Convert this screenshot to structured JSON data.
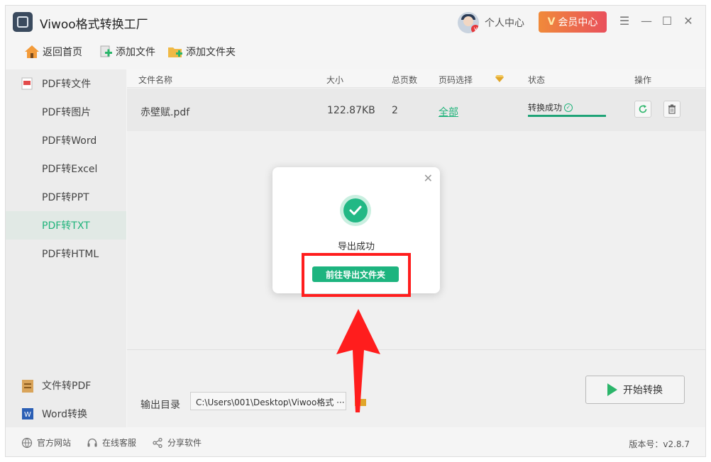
{
  "app": {
    "title": "Viwoo格式转换工厂"
  },
  "header": {
    "user_center": "个人中心",
    "vip_center": "会员中心",
    "vip_badge": "V"
  },
  "toolbar": {
    "home": "返回首页",
    "add_file": "添加文件",
    "add_folder": "添加文件夹"
  },
  "sidebar": {
    "items": [
      {
        "label": "PDF转文件",
        "icon": "pdf-file-icon"
      },
      {
        "label": "PDF转图片"
      },
      {
        "label": "PDF转Word"
      },
      {
        "label": "PDF转Excel"
      },
      {
        "label": "PDF转PPT"
      },
      {
        "label": "PDF转TXT",
        "active": true
      },
      {
        "label": "PDF转HTML"
      }
    ],
    "bottom": [
      {
        "label": "文件转PDF",
        "icon": "file-to-pdf-icon"
      },
      {
        "label": "Word转换",
        "icon": "word-icon"
      }
    ]
  },
  "table": {
    "headers": {
      "name": "文件名称",
      "size": "大小",
      "pages": "总页数",
      "page_select": "页码选择",
      "status": "状态",
      "actions": "操作"
    },
    "rows": [
      {
        "name": "赤壁赋.pdf",
        "size": "122.87KB",
        "pages": "2",
        "page_select": "全部",
        "status": "转换成功",
        "progress": 1.0
      }
    ]
  },
  "output": {
    "label": "输出目录",
    "path": "C:\\Users\\001\\Desktop\\Viwoo格式 ···"
  },
  "actions": {
    "start": "开始转换"
  },
  "footer": {
    "website": "官方网站",
    "support": "在线客服",
    "share": "分享软件",
    "version": "版本号：v2.8.7"
  },
  "modal": {
    "message": "导出成功",
    "button": "前往导出文件夹"
  },
  "colors": {
    "accent": "#1fb37a",
    "vip_start": "#f08a3a",
    "vip_end": "#e9505c",
    "highlight": "#ff1d1d"
  }
}
